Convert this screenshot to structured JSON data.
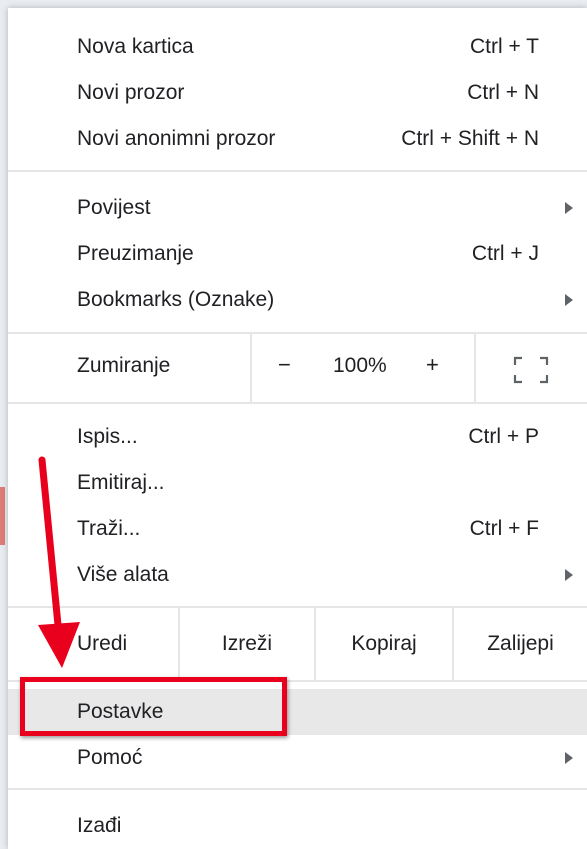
{
  "menu": {
    "group1": [
      {
        "label": "Nova kartica",
        "shortcut": "Ctrl + T"
      },
      {
        "label": "Novi prozor",
        "shortcut": "Ctrl + N"
      },
      {
        "label": "Novi anonimni prozor",
        "shortcut": "Ctrl + Shift + N"
      }
    ],
    "group2": [
      {
        "label": "Povijest",
        "submenu": true
      },
      {
        "label": "Preuzimanje",
        "shortcut": "Ctrl + J"
      },
      {
        "label": "Bookmarks (Oznake)",
        "submenu": true
      }
    ],
    "zoom": {
      "label": "Zumiranje",
      "minus": "−",
      "level": "100%",
      "plus": "+",
      "fullscreen_icon": "fullscreen-icon"
    },
    "group3": [
      {
        "label": "Ispis...",
        "shortcut": "Ctrl + P"
      },
      {
        "label": "Emitiraj..."
      },
      {
        "label": "Traži...",
        "shortcut": "Ctrl + F"
      },
      {
        "label": "Više alata",
        "submenu": true
      }
    ],
    "edit": {
      "label": "Uredi",
      "cut": "Izreži",
      "copy": "Kopiraj",
      "paste": "Zalijepi"
    },
    "group4": [
      {
        "label": "Postavke",
        "highlighted": true
      },
      {
        "label": "Pomoć",
        "submenu": true
      }
    ],
    "group5": [
      {
        "label": "Izađi"
      }
    ]
  },
  "annotation": {
    "color": "#e8001c",
    "arrow_icon": "arrow-down-icon"
  },
  "colors": {
    "menu_bg": "#ffffff",
    "highlight_bg": "#e8e8e8",
    "divider": "#e6e6e6",
    "text": "#202124"
  }
}
